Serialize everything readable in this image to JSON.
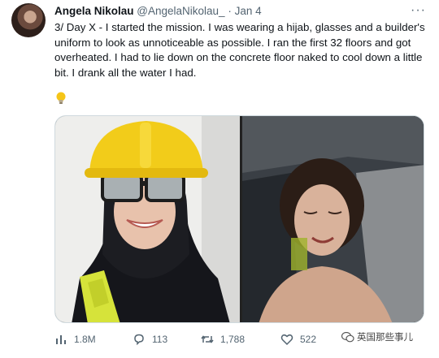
{
  "tweet": {
    "author_name": "Angela Nikolau",
    "author_handle": "@AngelaNikolau_",
    "separator": "·",
    "timestamp": "Jan 4",
    "more_label": "···",
    "text": "3/ Day X - I started the mission. I was wearing a hijab, glasses and a builder's uniform to look as unnoticeable as possible. I ran the first 32 floors and got overheated. I had to lie down on the concrete floor naked to cool down a little bit. I drank all the water I had.",
    "emoji_icon": "lightbulb-icon"
  },
  "media": {
    "left_photo": "selfie-hard-hat-photo",
    "right_photo": "lying-on-floor-photo"
  },
  "actions": {
    "views": "1.8M",
    "replies": "113",
    "retweets": "1,788",
    "likes": "522"
  },
  "watermark": {
    "text": "英国那些事儿"
  },
  "colors": {
    "secondary_text": "#536471",
    "primary_text": "#0f1419",
    "border": "#cfd9de",
    "helmet_yellow": "#f2cc1a",
    "vest_yellow": "#d6e33a"
  }
}
